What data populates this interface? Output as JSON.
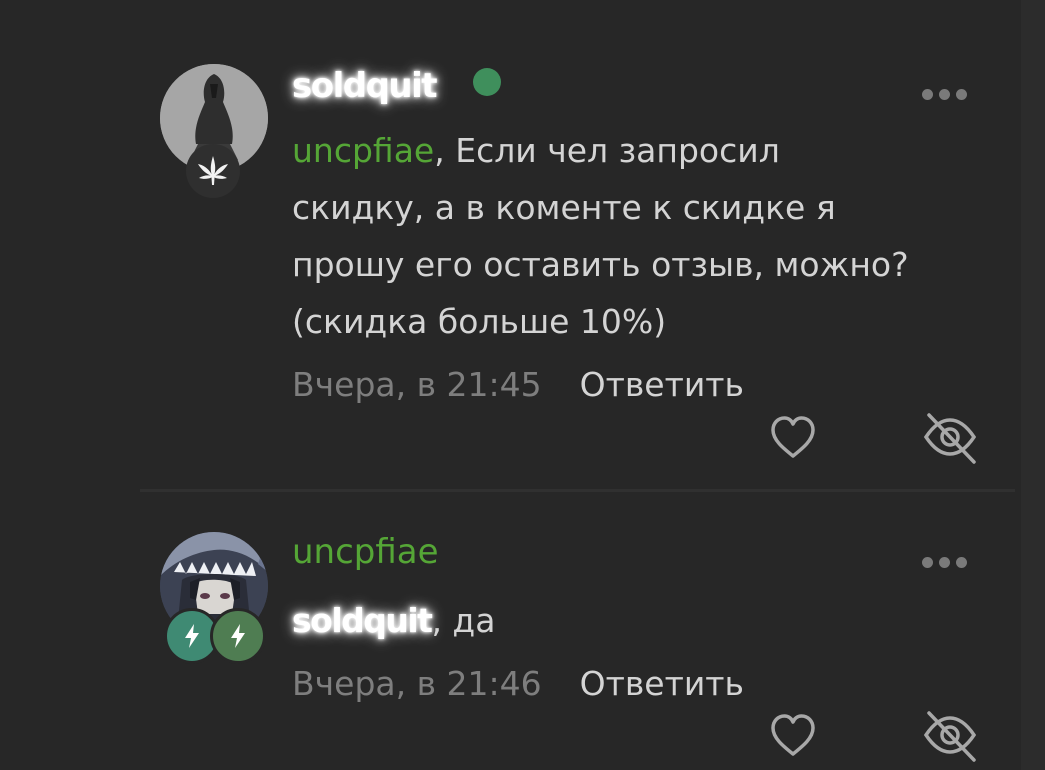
{
  "colors": {
    "background": "#272727",
    "text": "#d4d4d4",
    "mention": "#55a636",
    "muted": "#7e7e7e",
    "online": "#3f8f5c",
    "badge_green": "#4f7d52",
    "badge_teal": "#3f8a73"
  },
  "comments": [
    {
      "author": "soldquit",
      "author_style": "glowing-white",
      "online": true,
      "avatar_icon": "hooded-figure-avatar",
      "badge_icon": "cannabis-leaf-icon",
      "mention": "uncpfiae",
      "text_lines": [
        ", Если чел запросил",
        "скидку, а в коменте к скидке я",
        "прошу его оставить отзыв, можно?",
        "(скидка больше 10%)"
      ],
      "time": "Вчера, в 21:45",
      "reply_label": "Ответить",
      "actions": [
        "heart-icon",
        "eye-off-icon",
        "more-dots-icon"
      ]
    },
    {
      "author": "uncpfiae",
      "author_style": "green",
      "online": false,
      "avatar_icon": "anime-shark-hood-avatar",
      "badge_icons": [
        "lightning-icon",
        "lightning-icon"
      ],
      "mention": "soldquit",
      "text": ", да",
      "time": "Вчера, в 21:46",
      "reply_label": "Ответить",
      "actions": [
        "heart-icon",
        "eye-off-icon",
        "more-dots-icon"
      ]
    }
  ]
}
